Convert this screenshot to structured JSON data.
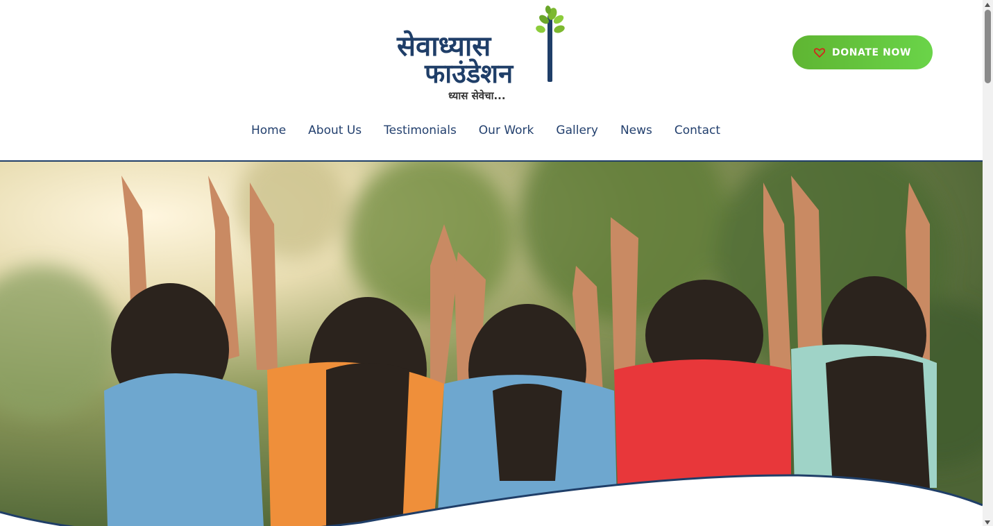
{
  "header": {
    "logo": {
      "title_line1": "सेवाध्यास",
      "title_line2": "फाउंडेशन",
      "tagline": "ध्यास सेवेचा..."
    },
    "donate_label": "DONATE NOW"
  },
  "nav": {
    "items": [
      {
        "label": "Home"
      },
      {
        "label": "About Us"
      },
      {
        "label": "Testimonials"
      },
      {
        "label": "Our Work"
      },
      {
        "label": "Gallery"
      },
      {
        "label": "News"
      },
      {
        "label": "Contact"
      }
    ]
  },
  "hero": {
    "image_desc_icon": "children-raising-hands-photo"
  },
  "colors": {
    "brand_blue": "#23406e",
    "brand_green": "#5fb532",
    "donate_green_light": "#6ad449"
  }
}
